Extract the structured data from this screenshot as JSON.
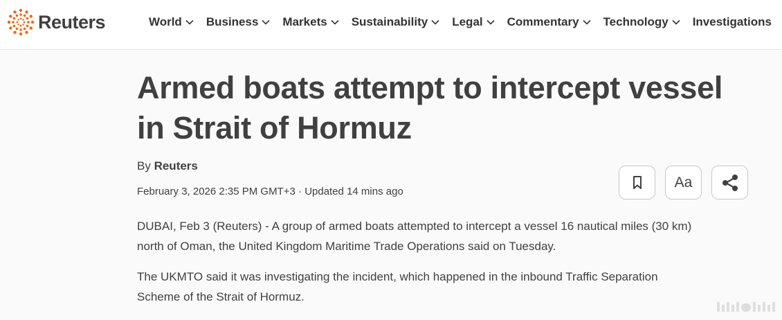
{
  "brand": {
    "name": "Reuters",
    "accent": "#fa6400"
  },
  "nav": {
    "items": [
      {
        "label": "World",
        "has_dropdown": true
      },
      {
        "label": "Business",
        "has_dropdown": true
      },
      {
        "label": "Markets",
        "has_dropdown": true
      },
      {
        "label": "Sustainability",
        "has_dropdown": true
      },
      {
        "label": "Legal",
        "has_dropdown": true
      },
      {
        "label": "Commentary",
        "has_dropdown": true
      },
      {
        "label": "Technology",
        "has_dropdown": true
      },
      {
        "label": "Investigations",
        "has_dropdown": false
      }
    ]
  },
  "article": {
    "headline_line1": "Armed boats attempt to intercept vessel",
    "headline_line2": "in Strait of Hormuz",
    "byline_prefix": "By",
    "author": "Reuters",
    "dateline": "February 3, 2026 2:35 PM GMT+3 · Updated 14 mins ago",
    "paragraph1_line1": "DUBAI, Feb 3 (Reuters) - A group of armed boats attempted to intercept a vessel 16 nautical miles (30 km)",
    "paragraph1_line2": "north of Oman, the United Kingdom Maritime Trade Operations said on Tuesday.",
    "paragraph2_line1": "The UKMTO said it was investigating the incident, which happened in the inbound Traffic Separation",
    "paragraph2_line2": "Scheme of the Strait of Hormuz."
  },
  "tools": {
    "bookmark_icon": "bookmark-icon",
    "text_size_label": "Aa",
    "share_icon": "share-icon"
  }
}
